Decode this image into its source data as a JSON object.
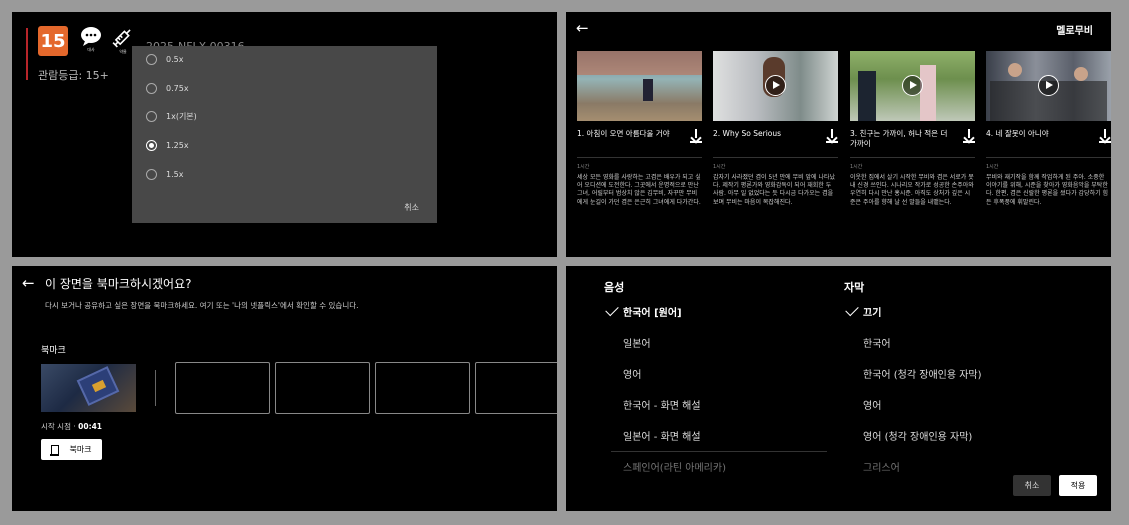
{
  "speed_panel": {
    "rating_badge": "15",
    "icon_labels": [
      "대사",
      "약물"
    ],
    "rating_code": "2025-NFLX-00316",
    "rating_text": "관람등급: 15+",
    "options": [
      {
        "label": "0.5x",
        "selected": false
      },
      {
        "label": "0.75x",
        "selected": false
      },
      {
        "label": "1x(기본)",
        "selected": false
      },
      {
        "label": "1.25x",
        "selected": true
      },
      {
        "label": "1.5x",
        "selected": false
      }
    ],
    "cancel_label": "취소"
  },
  "episodes_panel": {
    "back_label": "←",
    "title": "멜로무비",
    "episodes": [
      {
        "title": "1. 아침이 오면 아름다울 거야",
        "duration": "1시간",
        "description": "세상 모든 영화를 사랑하는 고겸은 배우가 되고 싶어 오디션에 도전한다. 그곳에서 운명적으로 만난 그녀, 어릴부터 범상치 않은 김무비, 자꾸만 무비에게 눈길이 가던 겸은 은근히 그녀에게 다가간다."
      },
      {
        "title": "2. Why So Serious",
        "duration": "1시간",
        "description": "갑자기 사라졌던 겸이 5년 만에 무비 앞에 나타났다. 제작기 평론가와 영화감독이 되어 재회한 두 사람. 아무 일 없었다는 듯 다시금 다가오는 겸을 보며 무비는 마음이 복잡해진다."
      },
      {
        "title": "3. 친구는 가까이, 허나 적은 더 가까이",
        "duration": "1시간",
        "description": "이웃한 집에서 살기 시작한 무비와 겸은 서로가 못내 신경 쓰인다. 시나리오 작가로 성공한 손주아와 우연히 다시 만난 홍시준. 아직도 상처가 깊은 시준은 주아를 향해 날 선 말들을 내뱉는다."
      },
      {
        "title": "4. 네 잘못이 아니야",
        "duration": "1시간",
        "description": "무비와 재기작을 함께 작업하게 된 주아. 소중한 이야기를 위해, 시준을 찾아가 영화음악을 부탁한다. 한편, 겸은 신랄한 평론을 썼다가 감당하기 힘든 후폭풍에 휘말린다."
      }
    ]
  },
  "bookmark_panel": {
    "title": "이 장면을 북마크하시겠어요?",
    "subtitle": "다시 보거나 공유하고 싶은 장면을 북마크하세요. 여기 또는 '나의 넷플릭스'에서 확인할 수 있습니다.",
    "section_label": "북마크",
    "start_label": "시작 시점 · ",
    "start_time": "00:41",
    "button_label": "북마크"
  },
  "lang_panel": {
    "audio_heading": "음성",
    "subtitle_heading": "자막",
    "audio_options": [
      {
        "label": "한국어 [원어]",
        "selected": true
      },
      {
        "label": "일본어",
        "selected": false
      },
      {
        "label": "영어",
        "selected": false
      },
      {
        "label": "한국어 - 화면 해설",
        "selected": false
      },
      {
        "label": "일본어 - 화면 해설",
        "selected": false
      },
      {
        "label": "스페인어(라틴 아메리카)",
        "selected": false
      }
    ],
    "subtitle_options": [
      {
        "label": "끄기",
        "selected": true
      },
      {
        "label": "한국어",
        "selected": false
      },
      {
        "label": "한국어 (청각 장애인용 자막)",
        "selected": false
      },
      {
        "label": "영어",
        "selected": false
      },
      {
        "label": "영어 (청각 장애인용 자막)",
        "selected": false
      },
      {
        "label": "그리스어",
        "selected": false
      }
    ],
    "cancel_label": "취소",
    "apply_label": "적용"
  }
}
